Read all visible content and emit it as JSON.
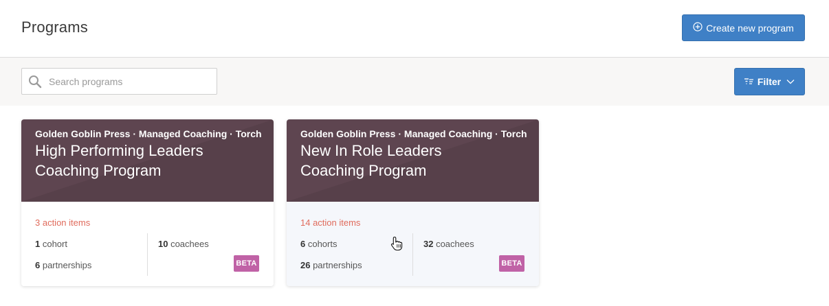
{
  "header": {
    "title": "Programs",
    "create_label": "Create new program"
  },
  "toolbar": {
    "search_placeholder": "Search programs",
    "search_value": "",
    "filter_label": "Filter"
  },
  "colors": {
    "primary": "#3f80c6",
    "card_header": "#5e4550",
    "action_items": "#e06b5c",
    "beta_badge": "#c062a6"
  },
  "icons": {
    "create": "plus-circle-icon",
    "search": "search-icon",
    "filter": "filter-icon",
    "dropdown": "chevron-down-icon"
  },
  "programs": [
    {
      "breadcrumb": "Golden Goblin Press · Managed Coaching · Torch ...",
      "title_line1": "High Performing Leaders",
      "title_line2": "Coaching Program",
      "action_items": "3 action items",
      "cohorts_count": "1",
      "cohorts_label": " cohort",
      "partnerships_count": "6",
      "partnerships_label": " partnerships",
      "coachees_count": "10",
      "coachees_label": " coachees",
      "badge": "BETA"
    },
    {
      "breadcrumb": "Golden Goblin Press · Managed Coaching · Torch ...",
      "title_line1": "New In Role Leaders",
      "title_line2": "Coaching Program",
      "action_items": "14 action items",
      "cohorts_count": "6",
      "cohorts_label": " cohorts",
      "partnerships_count": "26",
      "partnerships_label": " partnerships",
      "coachees_count": "32",
      "coachees_label": " coachees",
      "badge": "BETA"
    }
  ]
}
